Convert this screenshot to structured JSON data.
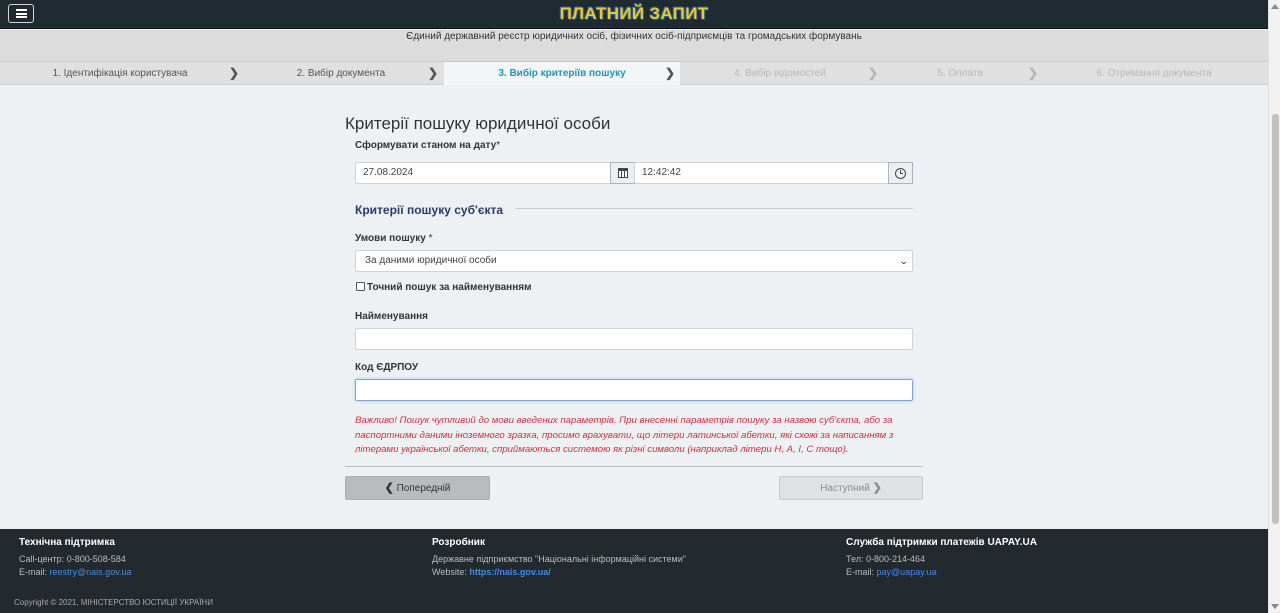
{
  "header": {
    "brand": "ПЛАТНИЙ ЗАПИТ",
    "menu_icon": "hamburger-icon",
    "subtitle": "Єдиний державний реєстр юридичних осіб, фізичних осіб-підприємців та громадських формувань"
  },
  "steps": [
    {
      "label": "1. Ідентифікація користувача",
      "state": "done"
    },
    {
      "label": "2. Вибір документа",
      "state": "done"
    },
    {
      "label": "3. Вибір критеріїв пошуку",
      "state": "active"
    },
    {
      "label": "4. Вибір відомостей",
      "state": "future"
    },
    {
      "label": "5. Оплата",
      "state": "future"
    },
    {
      "label": "6. Отримання документа",
      "state": "future"
    }
  ],
  "form": {
    "title": "Критерії пошуку юридичної особи",
    "date_label": "Сформувати станом на дату",
    "required_mark": "*",
    "date_value": "27.08.2024",
    "time_value": "12:42:42",
    "section_title": "Критерії пошуку суб'єкта",
    "conditions_label": "Умови пошуку",
    "conditions_value": "За даними юридичної особи",
    "exact_search_label": "Точний пошук за найменуванням",
    "exact_search_checked": false,
    "name_label": "Найменування",
    "name_value": "",
    "edrpou_label": "Код ЄДРПОУ",
    "edrpou_value": "",
    "warning": "Важливо! Пошук чутливий до мови введених параметрів. При внесенні параметрів пошуку за назвою суб'єкта, або за паспортними даними іноземного зразка, просимо врахувати, що літери латинської абетки, які схожі за написанням з літерами української абетки, сприймаються системою як різні символи (наприклад літери Н, А, І, С тощо).",
    "prev_label": "Попередній",
    "next_label": "Наступний"
  },
  "footer": {
    "support": {
      "title": "Технічна підтримка",
      "callcenter_label": "Call-центр:",
      "callcenter": "0-800-508-584",
      "email_label": "E-mail:",
      "email": "reestry@nais.gov.ua"
    },
    "developer": {
      "title": "Розробник",
      "org": "Державне підприємство \"Національні інформаційні системи\"",
      "website_label": "Website:",
      "website": "https://nais.gov.ua/"
    },
    "payments": {
      "title": "Служба підтримки платежів UAPAY.UA",
      "phone_label": "Тел:",
      "phone": "0-800-214-464",
      "email_label": "E-mail:",
      "email": "pay@uapay.ua"
    },
    "copyright": "Copyright © 2021, МІНІСТЕРСТВО ЮСТИЦІЇ УКРАЇНИ"
  },
  "colors": {
    "accent": "#1d98b6",
    "brand": "#f2c812",
    "warning": "#d1313d",
    "footer_bg": "#222a2e"
  }
}
